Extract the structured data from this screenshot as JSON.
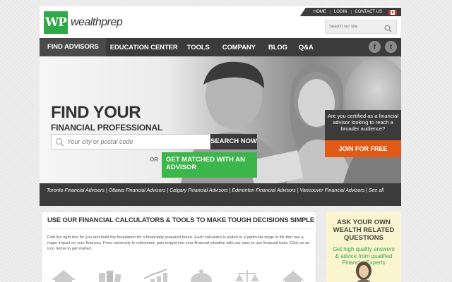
{
  "brand": {
    "logo_mark": "WP",
    "logo_text": "wealthprep"
  },
  "utility_nav": {
    "items": [
      "HOME",
      "LOGIN",
      "CONTACT US"
    ],
    "flag": "canada-flag-icon"
  },
  "search": {
    "placeholder": "Search our site"
  },
  "nav": {
    "items": [
      "FIND ADVISORS",
      "EDUCATION CENTER",
      "TOOLS",
      "COMPANY",
      "BLOG",
      "Q&A"
    ]
  },
  "social": {
    "facebook": "f",
    "twitter": "t"
  },
  "hero": {
    "title": "FIND YOUR",
    "subtitle": "FINANCIAL PROFESSIONAL",
    "location_placeholder": "Your city or postal code",
    "search_button": "SEARCH NOW",
    "or": "OR",
    "match_button": "GET MATCHED WITH AN ADVISOR",
    "cert_text": "Are you certified as a financial advisor looking to reach a broader audience?",
    "join_button": "JOIN FOR FREE"
  },
  "city_links": {
    "items": [
      "Toronto Financial Advisors",
      "Ottawa Financial Advisors",
      "Calgary Financial Advisors",
      "Edmonton Financial Advisors",
      "Vancouver Financial Advisors",
      "See all"
    ]
  },
  "main": {
    "title": "USE OUR FINANCIAL CALCULATORS & TOOLS TO MAKE TOUGH DECISIONS SIMPLE",
    "body": "Find the right tool for you and build the foundation for a financially prepared future. Each calculator is suited to a particular stage in life that has a major impact on your finances. From university to retirement, gain insight into your financial situation with our easy to use financial tools. Click on an icon below to get started.",
    "tools": [
      "house-icon",
      "books-icon",
      "chart-icon",
      "piggy-bank-icon",
      "scales-icon",
      "home-icon"
    ]
  },
  "side": {
    "title": "ASK YOUR OWN WEALTH RELATED QUESTIONS",
    "body": "Get high quality answers & advice from qualified Financial Experts"
  },
  "colors": {
    "green": "#3cb54a",
    "orange": "#e35a17",
    "dark": "#3b3b3b",
    "side_bg": "#faf5cf"
  }
}
